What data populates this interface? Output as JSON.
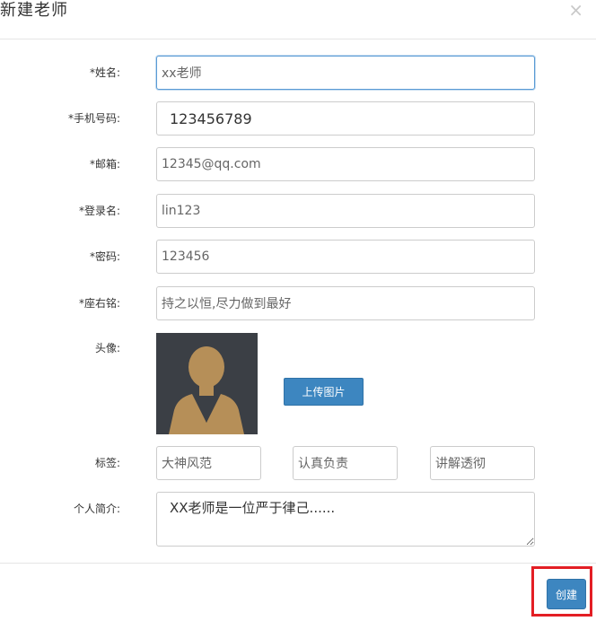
{
  "dialog": {
    "title": "新建老师",
    "close_symbol": "×"
  },
  "form": {
    "name": {
      "label": "*姓名:",
      "value": "xx老师"
    },
    "phone": {
      "label": "*手机号码:",
      "value": "123456789"
    },
    "email": {
      "label": "*邮箱:",
      "value": "12345@qq.com"
    },
    "login": {
      "label": "*登录名:",
      "value": "lin123"
    },
    "password": {
      "label": "*密码:",
      "value": "123456"
    },
    "motto": {
      "label": "*座右铭:",
      "value": "持之以恒,尽力做到最好"
    },
    "avatar": {
      "label": "头像:",
      "upload_label": "上传图片"
    },
    "tags": {
      "label": "标签:",
      "values": [
        "大神风范",
        "认真负责",
        "讲解透彻"
      ]
    },
    "bio": {
      "label": "个人简介:",
      "value": "XX老师是一位严于律己......"
    }
  },
  "footer": {
    "create_label": "创建"
  },
  "colors": {
    "primary": "#3d86c0",
    "highlight": "#e31e24",
    "focus_border": "#5a9bd5"
  }
}
